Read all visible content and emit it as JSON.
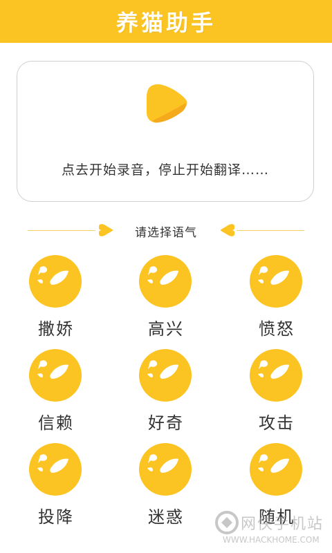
{
  "header": {
    "title": "养猫助手"
  },
  "record": {
    "hint": "点去开始录音，停止开始翻译……"
  },
  "tone": {
    "title": "请选择语气"
  },
  "moods": [
    {
      "label": "撒娇"
    },
    {
      "label": "高兴"
    },
    {
      "label": "愤怒"
    },
    {
      "label": "信赖"
    },
    {
      "label": "好奇"
    },
    {
      "label": "攻击"
    },
    {
      "label": "投降"
    },
    {
      "label": "迷惑"
    },
    {
      "label": "随机"
    }
  ],
  "watermark": {
    "cn": "网侠手机站",
    "en": "WWW.HACKHOME.COM"
  },
  "colors": {
    "accent": "#FCC423",
    "face": "#FCC423",
    "face_dark": "#F5AA1B"
  },
  "icons": {
    "play": "play-icon",
    "mood": "cat-face-icon",
    "heart": "heart-icon"
  }
}
